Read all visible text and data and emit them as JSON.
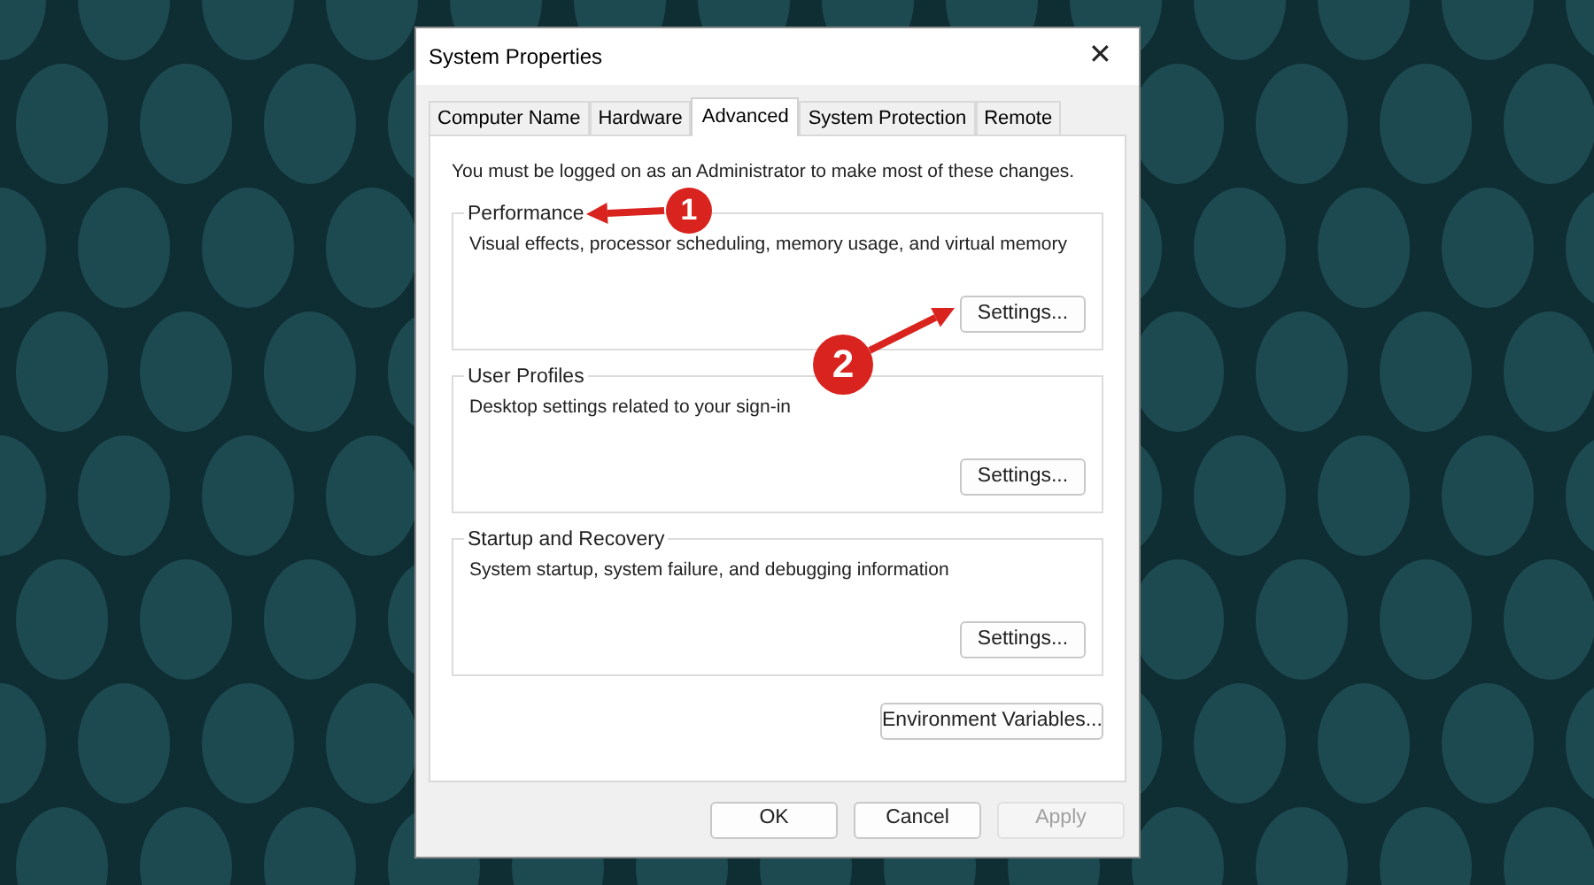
{
  "window": {
    "title": "System Properties",
    "close": "✕"
  },
  "tabs": [
    {
      "label": "Computer Name",
      "selected": false
    },
    {
      "label": "Hardware",
      "selected": false
    },
    {
      "label": "Advanced",
      "selected": true
    },
    {
      "label": "System Protection",
      "selected": false
    },
    {
      "label": "Remote",
      "selected": false
    }
  ],
  "notice": "You must be logged on as an Administrator to make most of these changes.",
  "groups": [
    {
      "title": "Performance",
      "description": "Visual effects, processor scheduling, memory usage, and virtual memory",
      "button": "Settings..."
    },
    {
      "title": "User Profiles",
      "description": "Desktop settings related to your sign-in",
      "button": "Settings..."
    },
    {
      "title": "Startup and Recovery",
      "description": "System startup, system failure, and debugging information",
      "button": "Settings..."
    }
  ],
  "environment_button": "Environment Variables...",
  "buttons": [
    {
      "label": "OK",
      "disabled": false
    },
    {
      "label": "Cancel",
      "disabled": false
    },
    {
      "label": "Apply",
      "disabled": true
    }
  ],
  "annotations": [
    {
      "number": "1"
    },
    {
      "number": "2"
    }
  ]
}
